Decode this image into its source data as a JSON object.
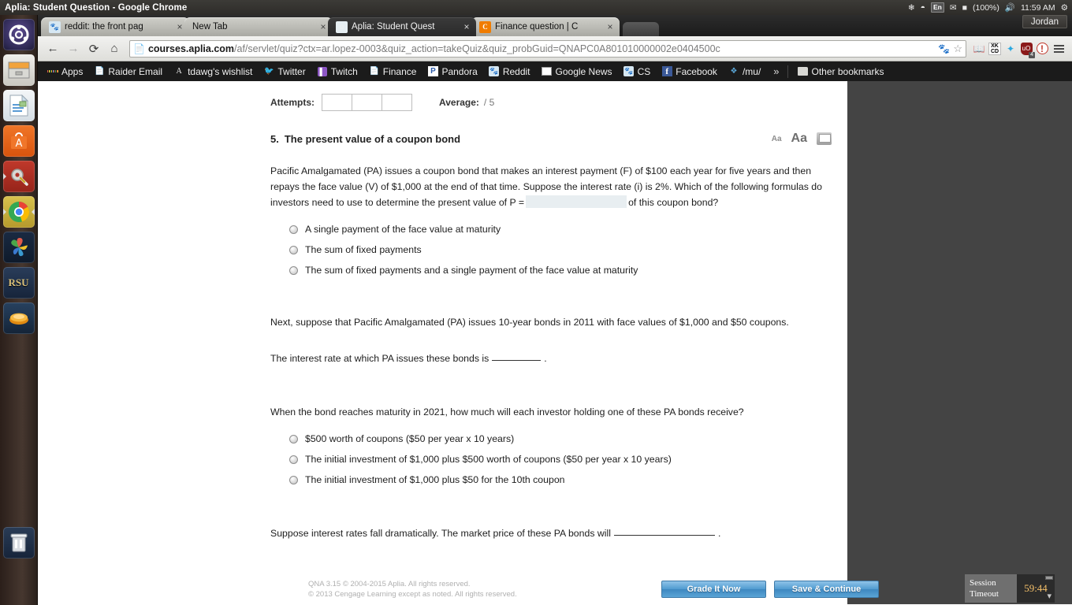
{
  "desktop": {
    "window_title": "Aplia: Student Question - Google Chrome",
    "user_name": "Jordan",
    "tray": {
      "battery": "(100%)",
      "clock": "11:59 AM",
      "keyboard_layout": "En"
    },
    "launcher_items": [
      {
        "name": "ubuntu-dash",
        "label": "Ubuntu Dash"
      },
      {
        "name": "files",
        "label": "Files"
      },
      {
        "name": "libreoffice-writer",
        "label": "LibreOffice Writer"
      },
      {
        "name": "ubuntu-software-center",
        "label": "Ubuntu Software Center"
      },
      {
        "name": "system-settings",
        "label": "System Settings"
      },
      {
        "name": "google-chrome",
        "label": "Google Chrome"
      },
      {
        "name": "pinwheel-app",
        "label": "Pinwheel"
      },
      {
        "name": "rsu",
        "label": "RSU"
      },
      {
        "name": "amber-app",
        "label": "Amber"
      },
      {
        "name": "trash",
        "label": "Trash"
      }
    ]
  },
  "browser": {
    "tabs": [
      {
        "title": "reddit: the front pag",
        "favicon": "reddit-icon",
        "active": false
      },
      {
        "title": "New Tab",
        "favicon": "none",
        "active": false
      },
      {
        "title": "Aplia: Student Quest",
        "favicon": "aplia-icon",
        "active": true
      },
      {
        "title": "Finance question | C",
        "title_dim": "",
        "favicon": "chegg-icon",
        "active": false
      }
    ],
    "omnibox": {
      "host": "courses.aplia.com",
      "path": "/af/servlet/quiz?ctx=ar.lopez-0003&quiz_action=takeQuiz&quiz_probGuid=QNAPC0A801010000002e0404500c"
    },
    "extensions": [
      {
        "name": "dictionary-extension",
        "label": "A"
      },
      {
        "name": "xkcd-extension",
        "label": "XKCD"
      },
      {
        "name": "blue-extension",
        "label": ""
      },
      {
        "name": "ublock-origin-extension",
        "label": "uO",
        "badge": "4"
      },
      {
        "name": "alert-extension",
        "label": "!"
      }
    ],
    "bookmarks": [
      {
        "label": "Apps",
        "icon": "apps-grid-icon"
      },
      {
        "label": "Raider Email",
        "icon": "page-icon"
      },
      {
        "label": "tdawg's wishlist",
        "icon": "amazon-a-icon"
      },
      {
        "label": "Twitter",
        "icon": "twitter-bird-icon"
      },
      {
        "label": "Twitch",
        "icon": "twitch-icon"
      },
      {
        "label": "Finance",
        "icon": "page-icon"
      },
      {
        "label": "Pandora",
        "icon": "pandora-icon"
      },
      {
        "label": "Reddit",
        "icon": "reddit-icon"
      },
      {
        "label": "Google News",
        "icon": "google-news-icon"
      },
      {
        "label": "CS",
        "icon": "reddit-icon"
      },
      {
        "label": "Facebook",
        "icon": "facebook-icon"
      },
      {
        "label": "/mu/",
        "icon": "fourchan-icon"
      }
    ],
    "bookmarks_overflow": "»",
    "other_bookmarks": "Other bookmarks"
  },
  "quiz": {
    "attempts_label": "Attempts:",
    "attempt_values": [
      "",
      "",
      ""
    ],
    "average_label": "Average:",
    "average_value": "/ 5",
    "question_number": "5.",
    "question_title": "The present value of a coupon bond",
    "tools": {
      "font_smaller": "Aa",
      "font_larger": "Aa",
      "print": "print-icon"
    },
    "prompt1_part1": "Pacific Amalgamated (PA) issues a coupon bond that makes an interest payment (F) of $100 each year for five years and then repays the face value (V) of $1,000 at the end of that time. Suppose the interest rate (i) is 2%. Which of the following formulas do investors need to use to determine the present value of P =",
    "prompt1_field_value": "",
    "prompt1_part2": "of this coupon bond?",
    "choices1": [
      "A single payment of the face value at maturity",
      "The sum of fixed payments",
      "The sum of fixed payments and a single payment of the face value at maturity"
    ],
    "prompt2": "Next, suppose that Pacific Amalgamated (PA) issues 10-year bonds in 2011 with face values of $1,000 and $50 coupons.",
    "prompt3_part1": "The interest rate at which PA issues these bonds is",
    "prompt3_blank": "",
    "prompt3_part2": ".",
    "prompt4": "When the bond reaches maturity in 2021, how much will each investor holding one of these PA bonds receive?",
    "choices2": [
      "$500 worth of coupons ($50 per year x 10 years)",
      "The initial investment of $1,000 plus $500 worth of coupons ($50 per year x 10 years)",
      "The initial investment of $1,000 plus $50 for the 10th coupon"
    ],
    "prompt5_part1": "Suppose interest rates fall dramatically. The market price of these PA bonds will",
    "prompt5_blank": "",
    "prompt5_part2": ".",
    "footer": {
      "copyright_line1": "QNA 3.15 © 2004-2015 Aplia. All rights reserved.",
      "copyright_line2": "© 2013 Cengage Learning except as noted. All rights reserved.",
      "grade_button": "Grade It Now",
      "save_button": "Save & Continue"
    }
  },
  "session_timeout": {
    "label_line1": "Session",
    "label_line2": "Timeout",
    "time": "59:44"
  }
}
